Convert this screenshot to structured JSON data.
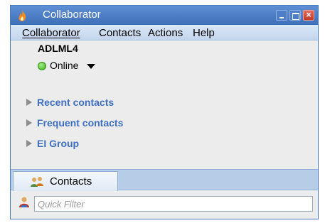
{
  "window": {
    "title": "Collaborator"
  },
  "menu": {
    "items": [
      {
        "label": "Collaborator"
      },
      {
        "label": "Contacts"
      },
      {
        "label": "Actions"
      },
      {
        "label": "Help"
      }
    ]
  },
  "user": {
    "name": "ADLML4",
    "status": "Online"
  },
  "groups": [
    {
      "label": "Recent contacts"
    },
    {
      "label": "Frequent contacts"
    },
    {
      "label": "EI Group"
    }
  ],
  "tabs": [
    {
      "label": "Contacts"
    }
  ],
  "filter": {
    "placeholder": "Quick Filter",
    "value": ""
  },
  "colors": {
    "titlebar": "#3e6fb8",
    "group_link": "#3e6fc4",
    "status_online": "#3fb21f",
    "close_button": "#c0392b"
  },
  "icons": {
    "app": "flame-icon",
    "minimize": "minimize-icon",
    "maximize": "maximize-icon",
    "close": "close-icon",
    "status": "online-dot-icon",
    "status_menu": "caret-down-icon",
    "group_expand": "triangle-right-icon",
    "tab": "contacts-people-icon",
    "filter": "person-filter-icon"
  }
}
